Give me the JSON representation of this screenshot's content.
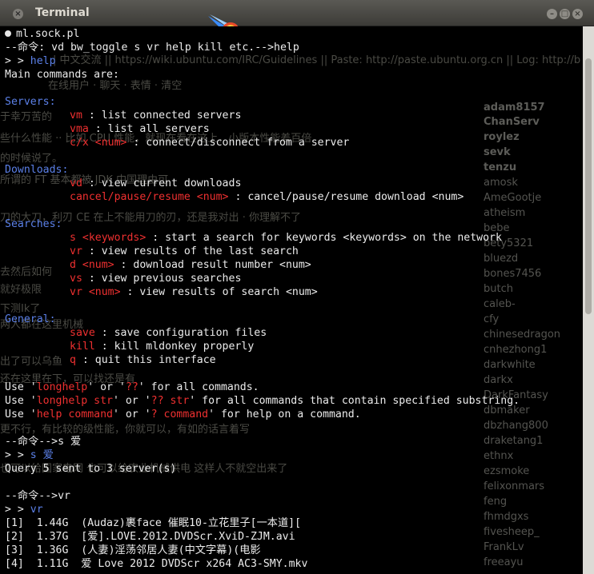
{
  "window": {
    "title": "Terminal"
  },
  "term": {
    "lines": [
      {
        "t": "ml.sock.pl"
      },
      {
        "t": "--命令: vd bw_toggle s vr help kill etc.-->help"
      },
      {
        "t": "> > help"
      },
      {
        "t": "Main commands are:"
      },
      {
        "t": "Servers:"
      },
      {
        "k": "vm",
        "d": " : list connected servers"
      },
      {
        "k": "vma",
        "d": " : list all servers"
      },
      {
        "k": "c/x <num>",
        "d": " : connect/disconnect from a server"
      },
      {
        "t": "Downloads:"
      },
      {
        "k": "vd",
        "d": " : view current downloads"
      },
      {
        "k": "cancel/pause/resume <num>",
        "d": " : cancel/pause/resume download <num>"
      },
      {
        "t": "Searches:"
      },
      {
        "k": "s <keywords>",
        "d": " : start a search for keywords <keywords> on the network"
      },
      {
        "k": "vr",
        "d": " : view results of the last search"
      },
      {
        "k": "d <num>",
        "d": " : download result number <num>"
      },
      {
        "k": "vs",
        "d": " : view previous searches"
      },
      {
        "k": "vr <num>",
        "d": " : view results of search <num>"
      },
      {
        "t": "General:"
      },
      {
        "k": "save",
        "d": " : save configuration files"
      },
      {
        "k": "kill",
        "d": " : kill mldonkey properly"
      },
      {
        "k": "q",
        "d": " : quit this interface"
      },
      {
        "u1": "Use '",
        "r1": "longhelp",
        "u2": "' or '",
        "r2": "??",
        "u3": "' for all commands."
      },
      {
        "u1": "Use '",
        "r1": "longhelp str",
        "u2": "' or '",
        "r2": "?? str",
        "u3": "' for all commands that contain specified substring."
      },
      {
        "u1": "Use '",
        "r1": "help command",
        "u2": "' or '",
        "r2": "? command",
        "u3": "' for help on a command."
      },
      {
        "t": "--命令-->s 爱"
      },
      {
        "t": "> > s 爱"
      },
      {
        "t": "Query 5 sent to 3 server(s)"
      },
      {
        "t": "--命令-->vr"
      },
      {
        "t": "> > vr"
      },
      {
        "t": "[1]  1.44G  (Audaz)裹face 催眠10-立花里子[一本道][ "
      },
      {
        "t": "[2]  1.37G  [爱].LOVE.2012.DVDScr.XviD-ZJM.avi"
      },
      {
        "t": "[3]  1.36G  (人妻)淫荡邻居人妻(中文字幕)(电影"
      },
      {
        "t": "[4]  1.11G  爱 Love 2012 DVDScr x264 AC3-SMY.mkv"
      }
    ]
  },
  "ghost": {
    "topic": "| 中文交流 || https://wiki.ubuntu.com/IRC/Guidelines || Paste: http://paste.ubuntu.org.cn || Log: http://b",
    "nicks": [
      "adam8157",
      "ChanServ",
      "roylez",
      "sevk",
      "tenzu",
      "amosk",
      "AmeGootje",
      "atheism",
      "bebe",
      "bety5321",
      "bluezd",
      "bones7456",
      "butch",
      "caleb-",
      "cfy",
      "chinesedragon",
      "cnhezhong1",
      "darkwhite",
      "darkx",
      "DarkFantasy",
      "dbmaker",
      "dbzhang800",
      "draketang1",
      "ethnx",
      "ezsmoke",
      "felixonmars",
      "feng",
      "fhmdgxs",
      "fivesheep_",
      "FrankLv",
      "freeayu"
    ],
    "chat": [
      "在线用户 · 聊天 · 表情 · 清空",
      "于幸万苦的",
      "些什么性能 ·· 比如 CPU 性能，就现在看在这上，小版本性能差百倍",
      "的时候说了。",
      "所谓的 FT 基本都被 JDK 中国理由可",
      "刀的大刀，利刃 CE 在上不能用刀的刃，还是我对出 · 你理解不了",
      "去然后如何",
      "就好极限",
      "下测Ik了",
      "两人都在这里机械",
      "出了可以乌鱼",
      "还在这里在下，可以找还是有",
      "更不行，有比较的级性能，你就可以，有如的话言着写",
      "也可以给国家电网 也可以给农业机械供电 这样人不就空出来了"
    ]
  }
}
